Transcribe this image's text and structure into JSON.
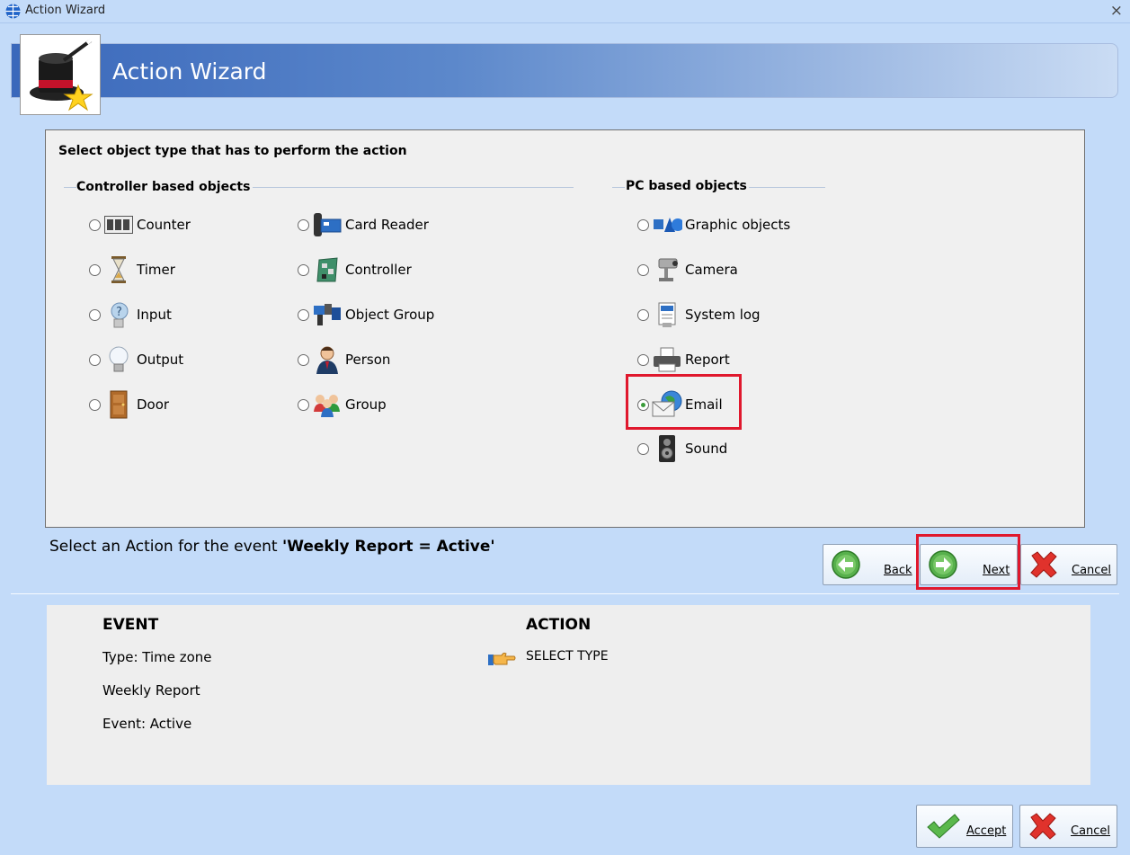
{
  "window": {
    "title": "Action Wizard",
    "close_glyph": "×"
  },
  "banner": {
    "title": "Action Wizard",
    "icon": "magic-hat-icon"
  },
  "panel": {
    "title": "Select object type that has to perform the action",
    "controller_group": {
      "label": "Controller based objects",
      "items": [
        {
          "label": "Counter",
          "icon": "counter-icon",
          "selected": false
        },
        {
          "label": "Timer",
          "icon": "hourglass-icon",
          "selected": false
        },
        {
          "label": "Input",
          "icon": "input-icon",
          "selected": false
        },
        {
          "label": "Output",
          "icon": "lightbulb-icon",
          "selected": false
        },
        {
          "label": "Door",
          "icon": "door-icon",
          "selected": false
        },
        {
          "label": "Card Reader",
          "icon": "card-reader-icon",
          "selected": false
        },
        {
          "label": "Controller",
          "icon": "controller-board-icon",
          "selected": false
        },
        {
          "label": "Object Group",
          "icon": "object-group-icon",
          "selected": false
        },
        {
          "label": "Person",
          "icon": "person-icon",
          "selected": false
        },
        {
          "label": "Group",
          "icon": "people-group-icon",
          "selected": false
        }
      ]
    },
    "pc_group": {
      "label": "PC based objects",
      "items": [
        {
          "label": "Graphic objects",
          "icon": "graphic-objects-icon",
          "selected": false
        },
        {
          "label": "Camera",
          "icon": "camera-icon",
          "selected": false
        },
        {
          "label": "System log",
          "icon": "system-log-icon",
          "selected": false
        },
        {
          "label": "Report",
          "icon": "printer-icon",
          "selected": false
        },
        {
          "label": "Email",
          "icon": "email-icon",
          "selected": true
        },
        {
          "label": "Sound",
          "icon": "speaker-icon",
          "selected": false
        }
      ]
    }
  },
  "prompt": {
    "text": "Select an Action for the event ",
    "event": "'Weekly Report = Active'"
  },
  "nav_buttons": {
    "back": "Back",
    "next": "Next",
    "cancel": "Cancel"
  },
  "summary": {
    "event_header": "EVENT",
    "event_type": "Type: Time zone",
    "event_name": "Weekly Report",
    "event_state": "Event: Active",
    "action_header": "ACTION",
    "action_value": "SELECT TYPE"
  },
  "footer_buttons": {
    "accept": "Accept",
    "cancel": "Cancel"
  },
  "colors": {
    "highlight": "#e0182d",
    "banner_start": "#3a68bb",
    "background": "#c3dbf9"
  }
}
